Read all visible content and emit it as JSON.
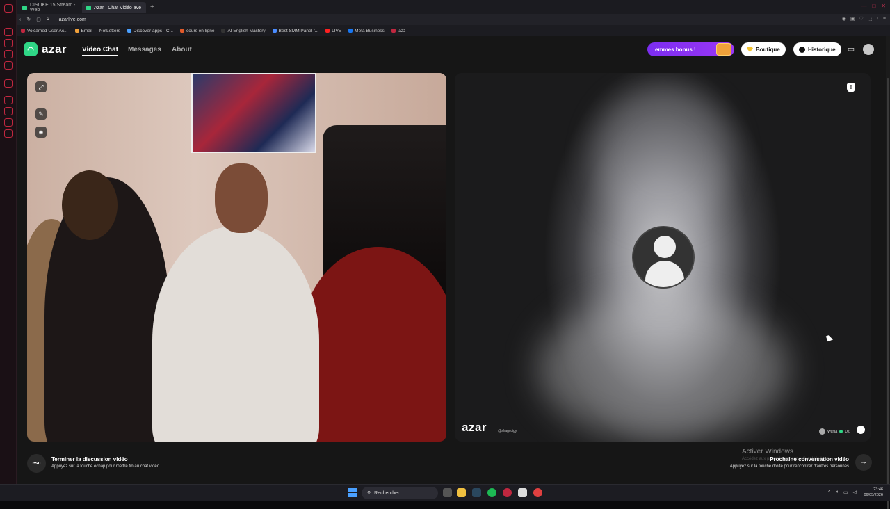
{
  "browser": {
    "tabs": [
      {
        "label": "DISLIKE.15 Stream - Web",
        "favicon_color": "#2fd686"
      },
      {
        "label": "Azar : Chat Vidéo ave",
        "favicon_color": "#2fd686"
      }
    ],
    "new_tab": "+",
    "url": "azarlive.com",
    "bookmarks": [
      {
        "label": "Volcamed User Ac...",
        "color": "#c0273f"
      },
      {
        "label": "Email — NotLetters",
        "color": "#f0a13a"
      },
      {
        "label": "Discover apps - C...",
        "color": "#4aa0ff"
      },
      {
        "label": "cours en ligne",
        "color": "#e05a2a"
      },
      {
        "label": "AI English Mastery",
        "color": "#333333"
      },
      {
        "label": "Best SMM Panel f...",
        "color": "#4a8cff"
      },
      {
        "label": "LIVE",
        "color": "#ff2020"
      },
      {
        "label": "Meta Business",
        "color": "#1877f2"
      },
      {
        "label": "jazz",
        "color": "#c0273f"
      }
    ]
  },
  "app": {
    "logo_text": "azar",
    "nav": {
      "video_chat": "Video Chat",
      "messages": "Messages",
      "about": "About"
    },
    "bonus_label": "emmes bonus !",
    "shop_label": "Boutique",
    "history_label": "Historique",
    "local_controls": [
      "⤢",
      "✎",
      "☻"
    ],
    "remote": {
      "watermark": "azar",
      "watermark_id": "@shagccigy",
      "peer_name": "Wafaa",
      "peer_country": "DZ",
      "report": "!",
      "chat": "…"
    },
    "bottom": {
      "esc_key": "esc",
      "end_title": "Terminer la discussion vidéo",
      "end_sub": "Appuyez sur la touche échap pour mettre fin au chat vidéo.",
      "next_title": "Prochaine conversation vidéo",
      "next_sub": "Appuyez sur la touche droite pour rencontrer d'autres personnes",
      "next_arrow": "→"
    },
    "activate_windows": "Activer Windows",
    "activate_windows_sub": "Accédez aux paramètres pour activer Windows."
  },
  "taskbar": {
    "search_placeholder": "Rechercher",
    "time": "23:46",
    "date": "06/05/2026"
  }
}
